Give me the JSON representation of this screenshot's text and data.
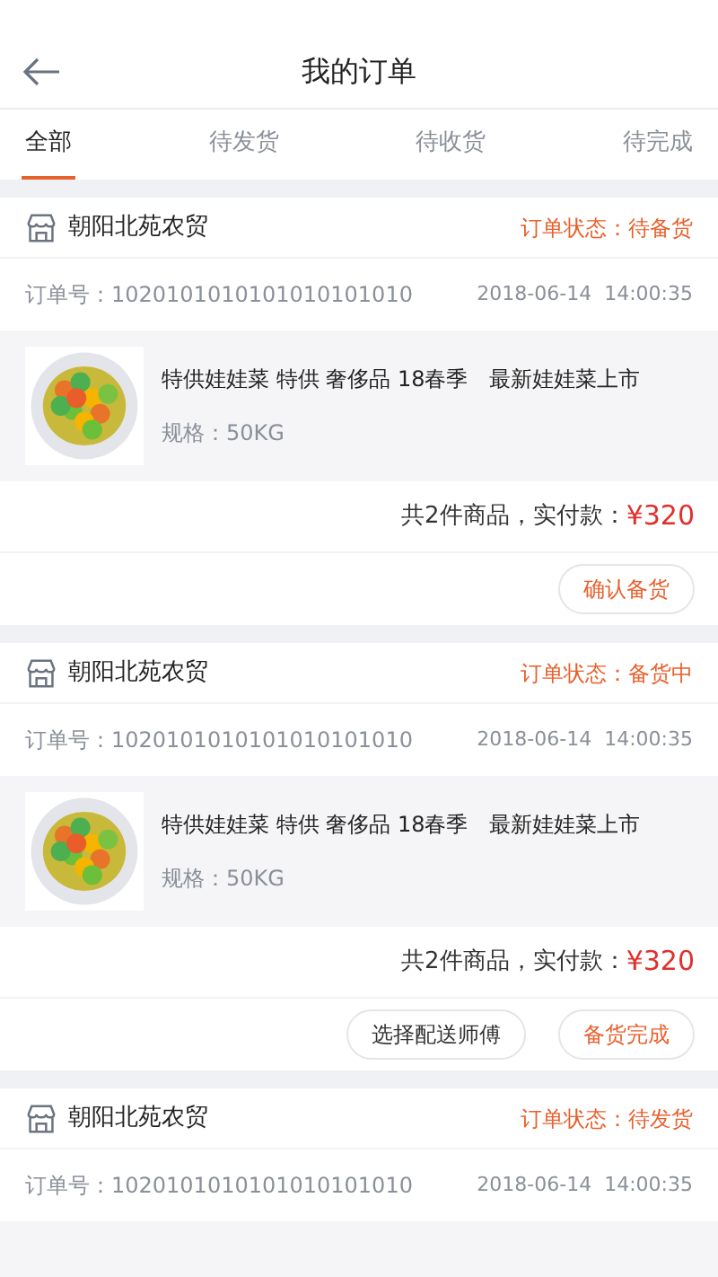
{
  "header": {
    "title": "我的订单"
  },
  "tabs": [
    {
      "label": "全部",
      "selected": true
    },
    {
      "label": "待发货",
      "selected": false
    },
    {
      "label": "待收货",
      "selected": false
    },
    {
      "label": "待完成",
      "selected": false
    }
  ],
  "orders": [
    {
      "shop": "朝阳北苑农贸",
      "status": "订单状态：待备货",
      "order_no": "订单号：1020101010101010101010",
      "time": "2018-06-14  14:00:35",
      "product": {
        "name": "特供娃娃菜 特供 奢侈品 18春季　最新娃娃菜上市",
        "spec": "规格：50KG"
      },
      "summary": "共2件商品，实付款：",
      "amount": "¥320",
      "buttons": [
        {
          "label": "确认备货",
          "highlighted": true
        }
      ]
    },
    {
      "shop": "朝阳北苑农贸",
      "status": "订单状态：备货中",
      "order_no": "订单号：1020101010101010101010",
      "time": "2018-06-14  14:00:35",
      "product": {
        "name": "特供娃娃菜 特供 奢侈品 18春季　最新娃娃菜上市",
        "spec": "规格：50KG"
      },
      "summary": "共2件商品，实付款：",
      "amount": "¥320",
      "buttons": [
        {
          "label": "选择配送师傅",
          "highlighted": false
        },
        {
          "label": "备货完成",
          "highlighted": true
        }
      ]
    },
    {
      "shop": "朝阳北苑农贸",
      "status": "订单状态：待发货",
      "order_no": "订单号：1020101010101010101010",
      "time": "2018-06-14  14:00:35"
    }
  ]
}
